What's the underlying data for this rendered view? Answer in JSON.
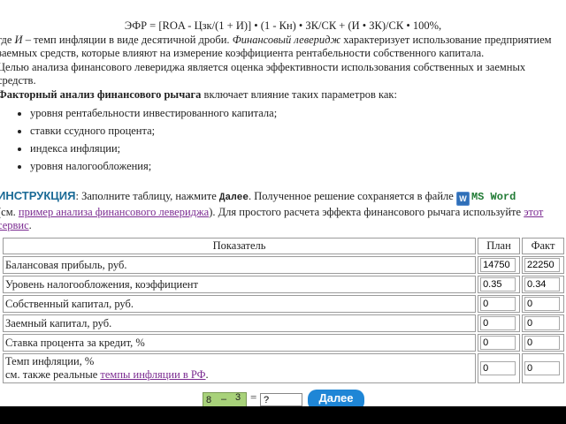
{
  "formula": "ЭФР = [ROA - Цзк/(1 + И)] • (1 - Кн) • ЗК/СК + (И • ЗК)/СК • 100%,",
  "para1": {
    "prefix": "где ",
    "var": "И",
    "mid": " – темп инфляции в виде десятичной дроби. ",
    "term": "Финансовый леверидж",
    "rest": " характеризует использование предприятием заемных средств, которые влияют на измерение коэффициента рентабельности собственного капитала."
  },
  "para2": "Целью анализа финансового левериджа является оценка эффективности использования собственных и заемных средств.",
  "factor": {
    "bold": "Факторный анализ финансового рычага",
    "rest": " включает влияние таких параметров как:"
  },
  "factors": [
    "уровня рентабельности инвестированного капитала;",
    "ставки ссудного процента;",
    "индекса инфляции;",
    "уровня налогообложения;"
  ],
  "instruction": {
    "head": "ИНСТРУКЦИЯ",
    "colon": ": ",
    "text1": "Заполните таблицу, нажмите ",
    "btn": "Далее",
    "text2": ". Полученное решение сохраняется в файле ",
    "word_icon": "W",
    "msword": "MS Word",
    "text3": "(см. ",
    "link1": "пример анализа финансового левериджа",
    "text4": "). Для простого расчета эффекта финансового рычага используйте ",
    "link2": "этот сервис",
    "text5": "."
  },
  "table": {
    "headers": {
      "name": "Показатель",
      "plan": "План",
      "fact": "Факт"
    },
    "rows": [
      {
        "label": "Балансовая прибыль, руб.",
        "plan": "14750",
        "fact": "22250"
      },
      {
        "label": "Уровень налогообложения, коэффициент",
        "plan": "0.35",
        "fact": "0.34"
      },
      {
        "label": "Собственный капитал, руб.",
        "plan": "0",
        "fact": "0"
      },
      {
        "label": "Заемный капитал, руб.",
        "plan": "0",
        "fact": "0"
      },
      {
        "label": "Ставка процента за кредит, %",
        "plan": "0",
        "fact": "0"
      }
    ],
    "inflation": {
      "line1": "Темп инфляции, %",
      "line2": "см. также реальные ",
      "link": "темпы инфляции в РФ",
      "dot": ".",
      "plan": "0",
      "fact": "0"
    }
  },
  "captcha": {
    "a": "8",
    "op": "–",
    "b": "3",
    "eq": "=",
    "answer": "?"
  },
  "next_button": "Далее"
}
